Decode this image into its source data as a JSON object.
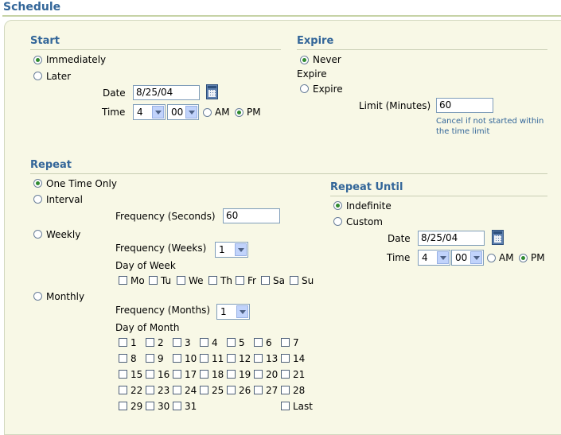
{
  "page_title": "Schedule",
  "start": {
    "title": "Start",
    "immediately": "Immediately",
    "later": "Later",
    "date_label": "Date",
    "date_value": "8/25/04",
    "time_label": "Time",
    "hour": "4",
    "minute": "00",
    "am": "AM",
    "pm": "PM",
    "selected": "Immediately",
    "ampm_selected": "PM"
  },
  "expire": {
    "title": "Expire",
    "never_line1": "Never",
    "never_line2": "Expire",
    "expire": "Expire",
    "limit_label": "Limit (Minutes)",
    "limit_value": "60",
    "hint_line1": "Cancel if not started within",
    "hint_line2": "the time limit",
    "selected": "Never Expire"
  },
  "repeat": {
    "title": "Repeat",
    "one_time": "One Time Only",
    "interval": "Interval",
    "freq_seconds_label": "Frequency (Seconds)",
    "freq_seconds_value": "60",
    "weekly": "Weekly",
    "freq_weeks_label": "Frequency (Weeks)",
    "freq_weeks_value": "1",
    "day_of_week_label": "Day of Week",
    "days_of_week": [
      "Mo",
      "Tu",
      "We",
      "Th",
      "Fr",
      "Sa",
      "Su"
    ],
    "monthly": "Monthly",
    "freq_months_label": "Frequency (Months)",
    "freq_months_value": "1",
    "day_of_month_label": "Day of Month",
    "days_of_month": [
      "1",
      "2",
      "3",
      "4",
      "5",
      "6",
      "7",
      "8",
      "9",
      "10",
      "11",
      "12",
      "13",
      "14",
      "15",
      "16",
      "17",
      "18",
      "19",
      "20",
      "21",
      "22",
      "23",
      "24",
      "25",
      "26",
      "27",
      "28",
      "29",
      "30",
      "31"
    ],
    "last": "Last",
    "selected": "One Time Only"
  },
  "repeat_until": {
    "title": "Repeat Until",
    "indefinite": "Indefinite",
    "custom": "Custom",
    "date_label": "Date",
    "date_value": "8/25/04",
    "time_label": "Time",
    "hour": "4",
    "minute": "00",
    "am": "AM",
    "pm": "PM",
    "selected": "Indefinite",
    "ampm_selected": "PM"
  },
  "colors": {
    "accent": "#336699",
    "panel_bg": "#f8f8e6",
    "radio_selected": "#2f8a2f"
  }
}
